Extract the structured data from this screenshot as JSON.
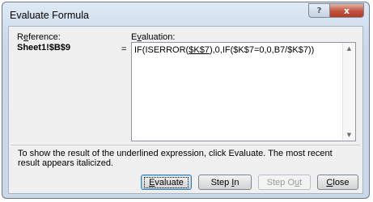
{
  "window": {
    "title": "Evaluate Formula",
    "help_glyph": "?",
    "close_glyph": "x"
  },
  "reference": {
    "label_pre": "R",
    "label_key": "e",
    "label_post": "ference:",
    "value": "Sheet1!$B$9"
  },
  "evaluation": {
    "label_pre": "E",
    "label_key": "v",
    "label_post": "aluation:",
    "equals": "=",
    "formula_pre": "IF(ISERROR(",
    "formula_underlined": "$K$7",
    "formula_post": "),0,IF($K$7=0,0,B7/$K$7))",
    "scroll_up_glyph": "▲",
    "scroll_down_glyph": "▼"
  },
  "info_text": "To show the result of the underlined expression, click Evaluate.  The most recent result appears italicized.",
  "buttons": {
    "evaluate": {
      "pre": "",
      "key": "E",
      "post": "valuate"
    },
    "step_in": {
      "pre": "Step ",
      "key": "I",
      "post": "n"
    },
    "step_out": {
      "pre": "Step O",
      "key": "u",
      "post": "t"
    },
    "close": {
      "pre": "",
      "key": "C",
      "post": "lose"
    }
  }
}
